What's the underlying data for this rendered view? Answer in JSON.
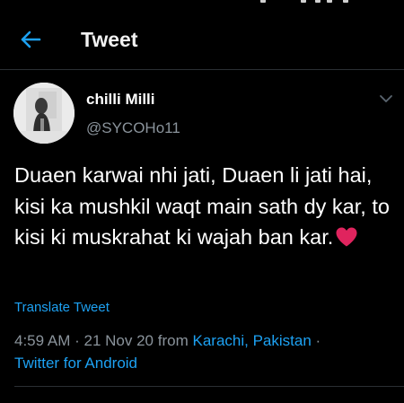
{
  "header": {
    "title": "Tweet",
    "back_icon": "arrow-left-icon"
  },
  "tweet": {
    "author": {
      "display_name": "chilli Milli",
      "handle": "@SYCOHo11",
      "avatar_icon": "avatar-photo"
    },
    "menu_icon": "chevron-down-icon",
    "text": "Duaen karwai nhi jati, Duaen li jati hai, kisi ka mushkil waqt main sath dy kar, to kisi ki muskrahat ki wajah ban kar.",
    "emoji": "red-heart-icon",
    "translate_label": "Translate Tweet",
    "meta": {
      "time": "4:59 AM",
      "separator": "·",
      "date": "21 Nov 20",
      "from_word": "from",
      "location": "Karachi, Pakistan",
      "separator2": "·",
      "source": "Twitter for Android"
    }
  },
  "colors": {
    "background": "#000000",
    "accent": "#1da1f2",
    "secondary_text": "#8a939b",
    "divider": "#2a2f33",
    "heart": "#e0245e"
  }
}
